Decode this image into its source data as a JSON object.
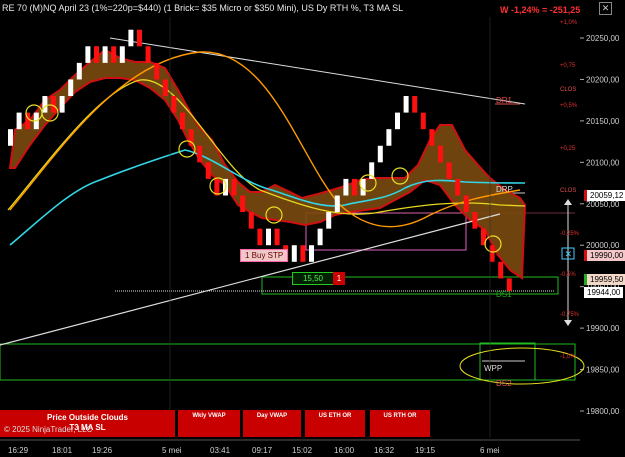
{
  "title": "RE 70 (M)NQ April 23 (1%=220p=$440) (1 Brick= $35 Micro or $350 Mini), US Dy RTH %, T3 MA SL",
  "pnl": "W -1,24% = -251,25",
  "close_symbol": "✕",
  "price_axis": {
    "labels": [
      "20250,00",
      "20200,00",
      "20150,00",
      "20100,00",
      "20050,00",
      "20000,00",
      "19950,00",
      "19900,00",
      "19850,00",
      "19800,00"
    ]
  },
  "pct_labels": [
    "+1,0%",
    "+0,75",
    "+0,5%",
    "+0,25",
    "-0,25%",
    "-0,5%",
    "-0,75%",
    "-1,0%"
  ],
  "level_labels": {
    "dr1": "DR1",
    "drp": "DRP",
    "ds1": "DS1",
    "wpp": "WPP",
    "ds2": "DS2",
    "clos": "CLOS",
    "clos2": "CLOS"
  },
  "price_tags": {
    "t1": "20059,12",
    "t2": "19990,00",
    "t3": "19959,50",
    "t4": "19944,00"
  },
  "time_axis": {
    "labels": [
      "16:29",
      "18:01",
      "19:26",
      "5 mei",
      "03:41",
      "09:17",
      "15:02",
      "16:00",
      "16:32",
      "19:15",
      "6 mei"
    ]
  },
  "order": {
    "buy_label": "1 Buy STP",
    "qty": "15,50",
    "qty_count": "1"
  },
  "buttons": {
    "price_outside": "Price Outside Clouds",
    "t3_ma_sl": "T3 MA SL",
    "wkly_vwap": "Wkly VWAP",
    "day_vwap": "Day VWAP",
    "eth_or": "US ETH OR",
    "rth_or": "US RTH OR"
  },
  "copyright": "© 2025 NinjaTrader, LLC",
  "colors": {
    "up": "#ffffff",
    "down": "#ff1010",
    "cloud": "#7a4a10",
    "cloud_edge": "#c81010",
    "t3": "#ff9a00",
    "ma_fast": "#33d6e6",
    "ma_slow": "#e6d820",
    "trend": "#ffffff"
  },
  "chart_data": {
    "type": "renko",
    "ylim": [
      19790,
      20270
    ],
    "bricks": [
      {
        "o": 20120,
        "c": 20140
      },
      {
        "o": 20140,
        "c": 20160
      },
      {
        "o": 20160,
        "c": 20140
      },
      {
        "o": 20140,
        "c": 20160
      },
      {
        "o": 20160,
        "c": 20180
      },
      {
        "o": 20180,
        "c": 20160
      },
      {
        "o": 20160,
        "c": 20180
      },
      {
        "o": 20180,
        "c": 20200
      },
      {
        "o": 20200,
        "c": 20220
      },
      {
        "o": 20220,
        "c": 20240
      },
      {
        "o": 20240,
        "c": 20220
      },
      {
        "o": 20220,
        "c": 20240
      },
      {
        "o": 20240,
        "c": 20220
      },
      {
        "o": 20220,
        "c": 20240
      },
      {
        "o": 20240,
        "c": 20260
      },
      {
        "o": 20260,
        "c": 20240
      },
      {
        "o": 20240,
        "c": 20220
      },
      {
        "o": 20220,
        "c": 20200
      },
      {
        "o": 20200,
        "c": 20180
      },
      {
        "o": 20180,
        "c": 20160
      },
      {
        "o": 20160,
        "c": 20140
      },
      {
        "o": 20140,
        "c": 20120
      },
      {
        "o": 20120,
        "c": 20100
      },
      {
        "o": 20100,
        "c": 20080
      },
      {
        "o": 20080,
        "c": 20060
      },
      {
        "o": 20060,
        "c": 20080
      },
      {
        "o": 20080,
        "c": 20060
      },
      {
        "o": 20060,
        "c": 20040
      },
      {
        "o": 20040,
        "c": 20020
      },
      {
        "o": 20020,
        "c": 20000
      },
      {
        "o": 20000,
        "c": 20020
      },
      {
        "o": 20020,
        "c": 20000
      },
      {
        "o": 20000,
        "c": 19980
      },
      {
        "o": 19980,
        "c": 20000
      },
      {
        "o": 20000,
        "c": 19980
      },
      {
        "o": 19980,
        "c": 20000
      },
      {
        "o": 20000,
        "c": 20020
      },
      {
        "o": 20020,
        "c": 20040
      },
      {
        "o": 20040,
        "c": 20060
      },
      {
        "o": 20060,
        "c": 20080
      },
      {
        "o": 20080,
        "c": 20060
      },
      {
        "o": 20060,
        "c": 20080
      },
      {
        "o": 20080,
        "c": 20100
      },
      {
        "o": 20100,
        "c": 20120
      },
      {
        "o": 20120,
        "c": 20140
      },
      {
        "o": 20140,
        "c": 20160
      },
      {
        "o": 20160,
        "c": 20180
      },
      {
        "o": 20180,
        "c": 20160
      },
      {
        "o": 20160,
        "c": 20140
      },
      {
        "o": 20140,
        "c": 20120
      },
      {
        "o": 20120,
        "c": 20100
      },
      {
        "o": 20100,
        "c": 20080
      },
      {
        "o": 20080,
        "c": 20060
      },
      {
        "o": 20060,
        "c": 20040
      },
      {
        "o": 20040,
        "c": 20020
      },
      {
        "o": 20020,
        "c": 20000
      },
      {
        "o": 20000,
        "c": 19980
      },
      {
        "o": 19980,
        "c": 19960
      },
      {
        "o": 19960,
        "c": 19945
      }
    ]
  }
}
